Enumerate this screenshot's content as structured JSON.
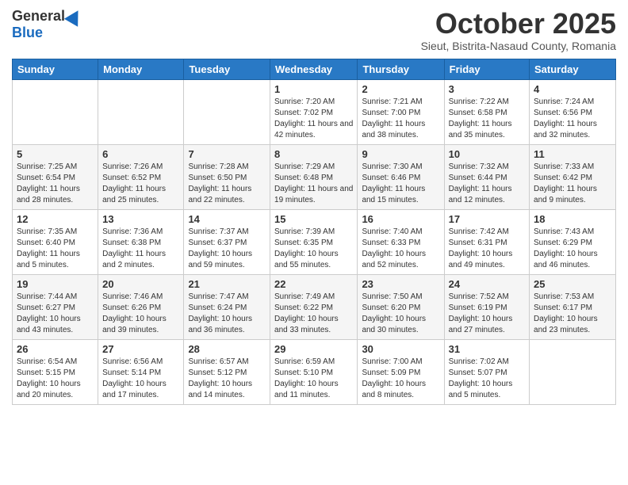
{
  "logo": {
    "general": "General",
    "blue": "Blue"
  },
  "title": "October 2025",
  "subtitle": "Sieut, Bistrita-Nasaud County, Romania",
  "days_of_week": [
    "Sunday",
    "Monday",
    "Tuesday",
    "Wednesday",
    "Thursday",
    "Friday",
    "Saturday"
  ],
  "weeks": [
    [
      {
        "day": "",
        "info": ""
      },
      {
        "day": "",
        "info": ""
      },
      {
        "day": "",
        "info": ""
      },
      {
        "day": "1",
        "info": "Sunrise: 7:20 AM\nSunset: 7:02 PM\nDaylight: 11 hours and 42 minutes."
      },
      {
        "day": "2",
        "info": "Sunrise: 7:21 AM\nSunset: 7:00 PM\nDaylight: 11 hours and 38 minutes."
      },
      {
        "day": "3",
        "info": "Sunrise: 7:22 AM\nSunset: 6:58 PM\nDaylight: 11 hours and 35 minutes."
      },
      {
        "day": "4",
        "info": "Sunrise: 7:24 AM\nSunset: 6:56 PM\nDaylight: 11 hours and 32 minutes."
      }
    ],
    [
      {
        "day": "5",
        "info": "Sunrise: 7:25 AM\nSunset: 6:54 PM\nDaylight: 11 hours and 28 minutes."
      },
      {
        "day": "6",
        "info": "Sunrise: 7:26 AM\nSunset: 6:52 PM\nDaylight: 11 hours and 25 minutes."
      },
      {
        "day": "7",
        "info": "Sunrise: 7:28 AM\nSunset: 6:50 PM\nDaylight: 11 hours and 22 minutes."
      },
      {
        "day": "8",
        "info": "Sunrise: 7:29 AM\nSunset: 6:48 PM\nDaylight: 11 hours and 19 minutes."
      },
      {
        "day": "9",
        "info": "Sunrise: 7:30 AM\nSunset: 6:46 PM\nDaylight: 11 hours and 15 minutes."
      },
      {
        "day": "10",
        "info": "Sunrise: 7:32 AM\nSunset: 6:44 PM\nDaylight: 11 hours and 12 minutes."
      },
      {
        "day": "11",
        "info": "Sunrise: 7:33 AM\nSunset: 6:42 PM\nDaylight: 11 hours and 9 minutes."
      }
    ],
    [
      {
        "day": "12",
        "info": "Sunrise: 7:35 AM\nSunset: 6:40 PM\nDaylight: 11 hours and 5 minutes."
      },
      {
        "day": "13",
        "info": "Sunrise: 7:36 AM\nSunset: 6:38 PM\nDaylight: 11 hours and 2 minutes."
      },
      {
        "day": "14",
        "info": "Sunrise: 7:37 AM\nSunset: 6:37 PM\nDaylight: 10 hours and 59 minutes."
      },
      {
        "day": "15",
        "info": "Sunrise: 7:39 AM\nSunset: 6:35 PM\nDaylight: 10 hours and 55 minutes."
      },
      {
        "day": "16",
        "info": "Sunrise: 7:40 AM\nSunset: 6:33 PM\nDaylight: 10 hours and 52 minutes."
      },
      {
        "day": "17",
        "info": "Sunrise: 7:42 AM\nSunset: 6:31 PM\nDaylight: 10 hours and 49 minutes."
      },
      {
        "day": "18",
        "info": "Sunrise: 7:43 AM\nSunset: 6:29 PM\nDaylight: 10 hours and 46 minutes."
      }
    ],
    [
      {
        "day": "19",
        "info": "Sunrise: 7:44 AM\nSunset: 6:27 PM\nDaylight: 10 hours and 43 minutes."
      },
      {
        "day": "20",
        "info": "Sunrise: 7:46 AM\nSunset: 6:26 PM\nDaylight: 10 hours and 39 minutes."
      },
      {
        "day": "21",
        "info": "Sunrise: 7:47 AM\nSunset: 6:24 PM\nDaylight: 10 hours and 36 minutes."
      },
      {
        "day": "22",
        "info": "Sunrise: 7:49 AM\nSunset: 6:22 PM\nDaylight: 10 hours and 33 minutes."
      },
      {
        "day": "23",
        "info": "Sunrise: 7:50 AM\nSunset: 6:20 PM\nDaylight: 10 hours and 30 minutes."
      },
      {
        "day": "24",
        "info": "Sunrise: 7:52 AM\nSunset: 6:19 PM\nDaylight: 10 hours and 27 minutes."
      },
      {
        "day": "25",
        "info": "Sunrise: 7:53 AM\nSunset: 6:17 PM\nDaylight: 10 hours and 23 minutes."
      }
    ],
    [
      {
        "day": "26",
        "info": "Sunrise: 6:54 AM\nSunset: 5:15 PM\nDaylight: 10 hours and 20 minutes."
      },
      {
        "day": "27",
        "info": "Sunrise: 6:56 AM\nSunset: 5:14 PM\nDaylight: 10 hours and 17 minutes."
      },
      {
        "day": "28",
        "info": "Sunrise: 6:57 AM\nSunset: 5:12 PM\nDaylight: 10 hours and 14 minutes."
      },
      {
        "day": "29",
        "info": "Sunrise: 6:59 AM\nSunset: 5:10 PM\nDaylight: 10 hours and 11 minutes."
      },
      {
        "day": "30",
        "info": "Sunrise: 7:00 AM\nSunset: 5:09 PM\nDaylight: 10 hours and 8 minutes."
      },
      {
        "day": "31",
        "info": "Sunrise: 7:02 AM\nSunset: 5:07 PM\nDaylight: 10 hours and 5 minutes."
      },
      {
        "day": "",
        "info": ""
      }
    ]
  ]
}
